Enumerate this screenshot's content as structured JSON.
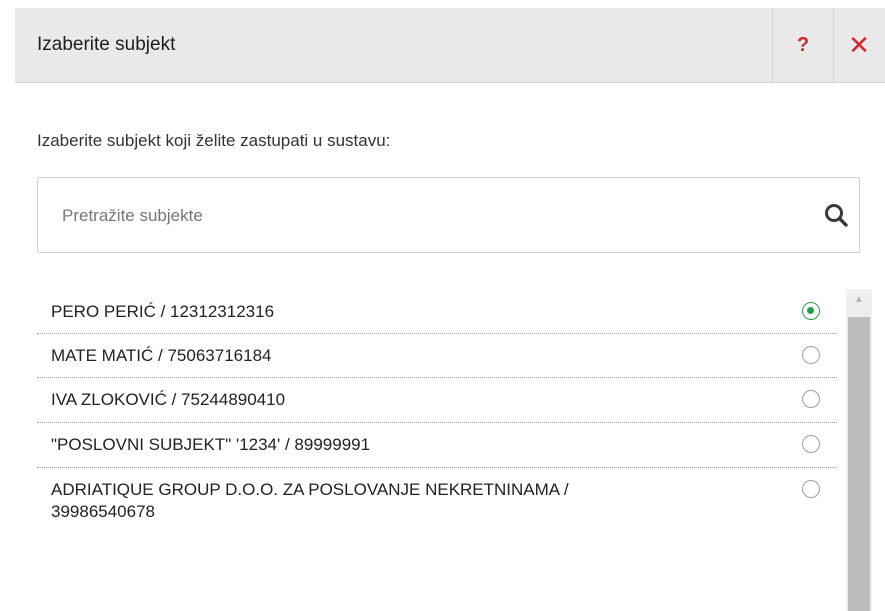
{
  "dialog": {
    "title": "Izaberite subjekt",
    "help_label": "?",
    "close_label": "✕"
  },
  "intro_text": "Izaberite subjekt koji želite zastupati u sustavu:",
  "search": {
    "placeholder": "Pretražite subjekte",
    "value": "",
    "icon": "search-icon"
  },
  "subjects": [
    {
      "label": "PERO PERIĆ / 12312312316",
      "selected": true
    },
    {
      "label": "MATE MATIĆ / 75063716184",
      "selected": false
    },
    {
      "label": "IVA ZLOKOVIĆ / 75244890410",
      "selected": false
    },
    {
      "label": "\"POSLOVNI SUBJEKT\" '1234' / 89999991",
      "selected": false
    },
    {
      "label": "ADRIATIQUE GROUP D.O.O. ZA POSLOVANJE NEKRETNINAMA / 39986540678",
      "label_line1": "ADRIATIQUE GROUP D.O.O. ZA POSLOVANJE NEKRETNINAMA /",
      "label_line2": "39986540678",
      "selected": false
    }
  ],
  "colors": {
    "accent_red": "#d7262c",
    "selected_green": "#2a9a4a",
    "header_bg": "#e9e9e9"
  }
}
